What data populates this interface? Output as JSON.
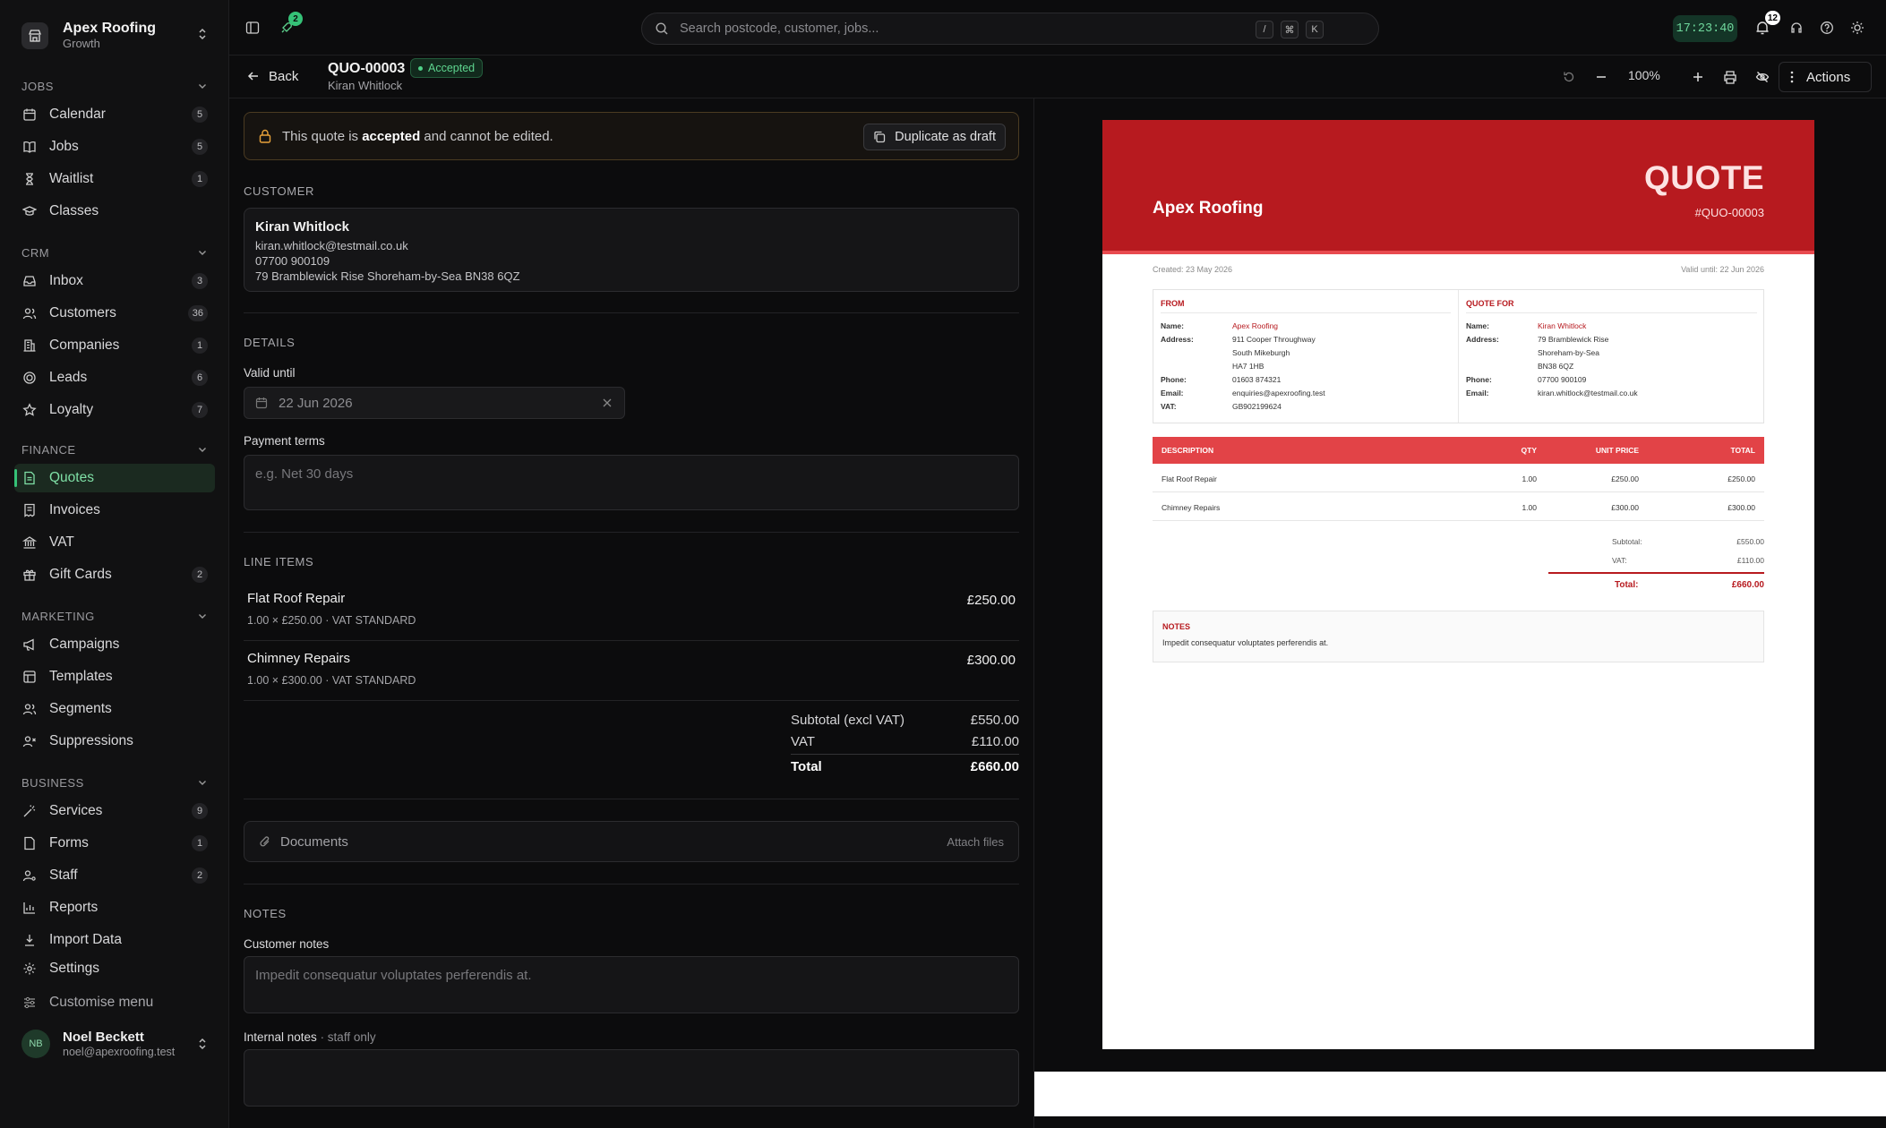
{
  "org": {
    "name": "Apex Roofing",
    "plan": "Growth"
  },
  "sidebar": {
    "sections": [
      {
        "title": "JOBS",
        "items": [
          {
            "label": "Calendar",
            "badge": "5",
            "icon": "calendar-icon"
          },
          {
            "label": "Jobs",
            "badge": "5",
            "icon": "book-icon"
          },
          {
            "label": "Waitlist",
            "badge": "1",
            "icon": "hourglass-icon"
          },
          {
            "label": "Classes",
            "badge": "",
            "icon": "graduation-cap-icon"
          }
        ]
      },
      {
        "title": "CRM",
        "items": [
          {
            "label": "Inbox",
            "badge": "3",
            "icon": "inbox-icon"
          },
          {
            "label": "Customers",
            "badge": "36",
            "icon": "users-icon"
          },
          {
            "label": "Companies",
            "badge": "1",
            "icon": "building-icon"
          },
          {
            "label": "Leads",
            "badge": "6",
            "icon": "target-icon"
          },
          {
            "label": "Loyalty",
            "badge": "7",
            "icon": "star-icon"
          }
        ]
      },
      {
        "title": "FINANCE",
        "items": [
          {
            "label": "Quotes",
            "badge": "",
            "icon": "file-text-icon",
            "active": true
          },
          {
            "label": "Invoices",
            "badge": "",
            "icon": "receipt-icon"
          },
          {
            "label": "VAT",
            "badge": "",
            "icon": "landmark-icon"
          },
          {
            "label": "Gift Cards",
            "badge": "2",
            "icon": "gift-icon"
          }
        ]
      },
      {
        "title": "MARKETING",
        "items": [
          {
            "label": "Campaigns",
            "badge": "",
            "icon": "megaphone-icon"
          },
          {
            "label": "Templates",
            "badge": "",
            "icon": "layout-icon"
          },
          {
            "label": "Segments",
            "badge": "",
            "icon": "users-icon"
          },
          {
            "label": "Suppressions",
            "badge": "",
            "icon": "user-x-icon"
          }
        ]
      },
      {
        "title": "BUSINESS",
        "items": [
          {
            "label": "Services",
            "badge": "9",
            "icon": "wand-icon"
          },
          {
            "label": "Forms",
            "badge": "1",
            "icon": "file-icon"
          },
          {
            "label": "Staff",
            "badge": "2",
            "icon": "user-cog-icon"
          },
          {
            "label": "Reports",
            "badge": "",
            "icon": "bar-chart-icon"
          },
          {
            "label": "Import Data",
            "badge": "",
            "icon": "import-icon"
          },
          {
            "label": "Settings",
            "badge": "",
            "icon": "gear-icon"
          }
        ]
      }
    ],
    "customise": "Customise menu",
    "user": {
      "initials": "NB",
      "name": "Noel Beckett",
      "email": "noel@apexroofing.test"
    }
  },
  "topbar": {
    "rocket_badge": "2",
    "search_placeholder": "Search postcode, customer, jobs...",
    "kbd": [
      "/",
      "⌘",
      "K"
    ],
    "clock": "17:23:40",
    "notif_count": "12"
  },
  "header": {
    "back": "Back",
    "quote_id": "QUO-00003",
    "status": "Accepted",
    "customer": "Kiran Whitlock",
    "zoom": "100%",
    "actions": "Actions"
  },
  "form": {
    "banner": {
      "pre": "This quote is ",
      "bold": "accepted",
      "post": " and cannot be edited.",
      "button": "Duplicate as draft"
    },
    "customer_heading": "CUSTOMER",
    "customer": {
      "name": "Kiran Whitlock",
      "email": "kiran.whitlock@testmail.co.uk",
      "phone": "07700 900109",
      "address": "79 Bramblewick Rise Shoreham-by-Sea BN38 6QZ"
    },
    "details_heading": "DETAILS",
    "valid_until_label": "Valid until",
    "valid_until": "22 Jun 2026",
    "payment_terms_label": "Payment terms",
    "payment_terms_placeholder": "e.g. Net 30 days",
    "line_items_heading": "LINE ITEMS",
    "line_items": [
      {
        "title": "Flat Roof Repair",
        "meta": "1.00 × £250.00 · VAT STANDARD",
        "price": "£250.00"
      },
      {
        "title": "Chimney Repairs",
        "meta": "1.00 × £300.00 · VAT STANDARD",
        "price": "£300.00"
      }
    ],
    "totals": {
      "subtotal_label": "Subtotal (excl VAT)",
      "subtotal": "£550.00",
      "vat_label": "VAT",
      "vat": "£110.00",
      "total_label": "Total",
      "total": "£660.00"
    },
    "documents": {
      "label": "Documents",
      "action": "Attach files"
    },
    "notes_heading": "NOTES",
    "customer_notes_label": "Customer notes",
    "customer_notes": "Impedit consequatur voluptates perferendis at.",
    "internal_notes_label": "Internal notes",
    "internal_notes_hint": " · staff only"
  },
  "preview": {
    "company": "Apex Roofing",
    "title": "QUOTE",
    "number": "#QUO-00003",
    "created": "Created: 23 May 2026",
    "valid": "Valid until: 22 Jun 2026",
    "from_heading": "FROM",
    "from": [
      {
        "k": "Name:",
        "v": "Apex Roofing",
        "red": true
      },
      {
        "k": "Address:",
        "v": "911 Cooper Throughway"
      },
      {
        "k": "",
        "v": "South Mikeburgh"
      },
      {
        "k": "",
        "v": "HA7 1HB"
      },
      {
        "k": "Phone:",
        "v": "01603 874321"
      },
      {
        "k": "Email:",
        "v": "enquiries@apexroofing.test"
      },
      {
        "k": "VAT:",
        "v": "GB902199624"
      }
    ],
    "for_heading": "QUOTE FOR",
    "for": [
      {
        "k": "Name:",
        "v": "Kiran Whitlock",
        "red": true
      },
      {
        "k": "Address:",
        "v": "79 Bramblewick Rise"
      },
      {
        "k": "",
        "v": "Shoreham-by-Sea"
      },
      {
        "k": "",
        "v": "BN38 6QZ"
      },
      {
        "k": "Phone:",
        "v": "07700 900109"
      },
      {
        "k": "Email:",
        "v": "kiran.whitlock@testmail.co.uk"
      }
    ],
    "table_headers": [
      "DESCRIPTION",
      "QTY",
      "UNIT PRICE",
      "TOTAL"
    ],
    "rows": [
      [
        "Flat Roof Repair",
        "1.00",
        "£250.00",
        "£250.00"
      ],
      [
        "Chimney Repairs",
        "1.00",
        "£300.00",
        "£300.00"
      ]
    ],
    "subtotal_label": "Subtotal:",
    "subtotal": "£550.00",
    "vat_label": "VAT:",
    "vat": "£110.00",
    "total_label": "Total:",
    "total": "£660.00",
    "notes_heading": "NOTES",
    "notes": "Impedit consequatur voluptates perferendis at."
  },
  "colors": {
    "accent": "#35c277",
    "brand_red": "#b71a1f",
    "table_red": "#e24347"
  }
}
